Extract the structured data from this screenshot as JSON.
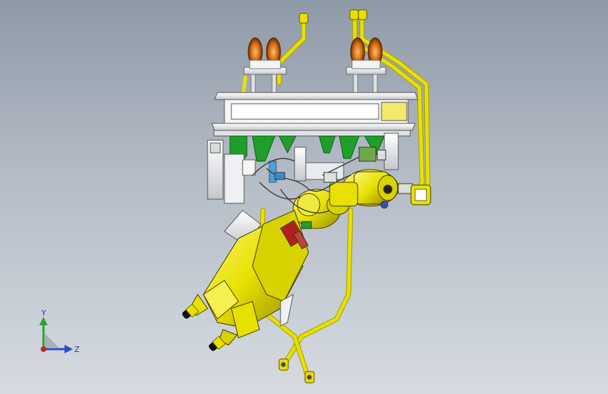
{
  "viewport": {
    "background_top": "#8f9aa8",
    "background_bottom": "#d6dbe1",
    "model_colors": {
      "yellow": "#e8e000",
      "yellow_dark": "#8f8a00",
      "green": "#1f9e2a",
      "steel": "#e6e8ea",
      "orange": "#d96a10",
      "red": "#b02020"
    }
  },
  "triad": {
    "y_label": "Y",
    "z_label": "Z",
    "y_color": "#2aa52a",
    "z_color": "#2a4ad0",
    "x_color": "#d02020"
  }
}
